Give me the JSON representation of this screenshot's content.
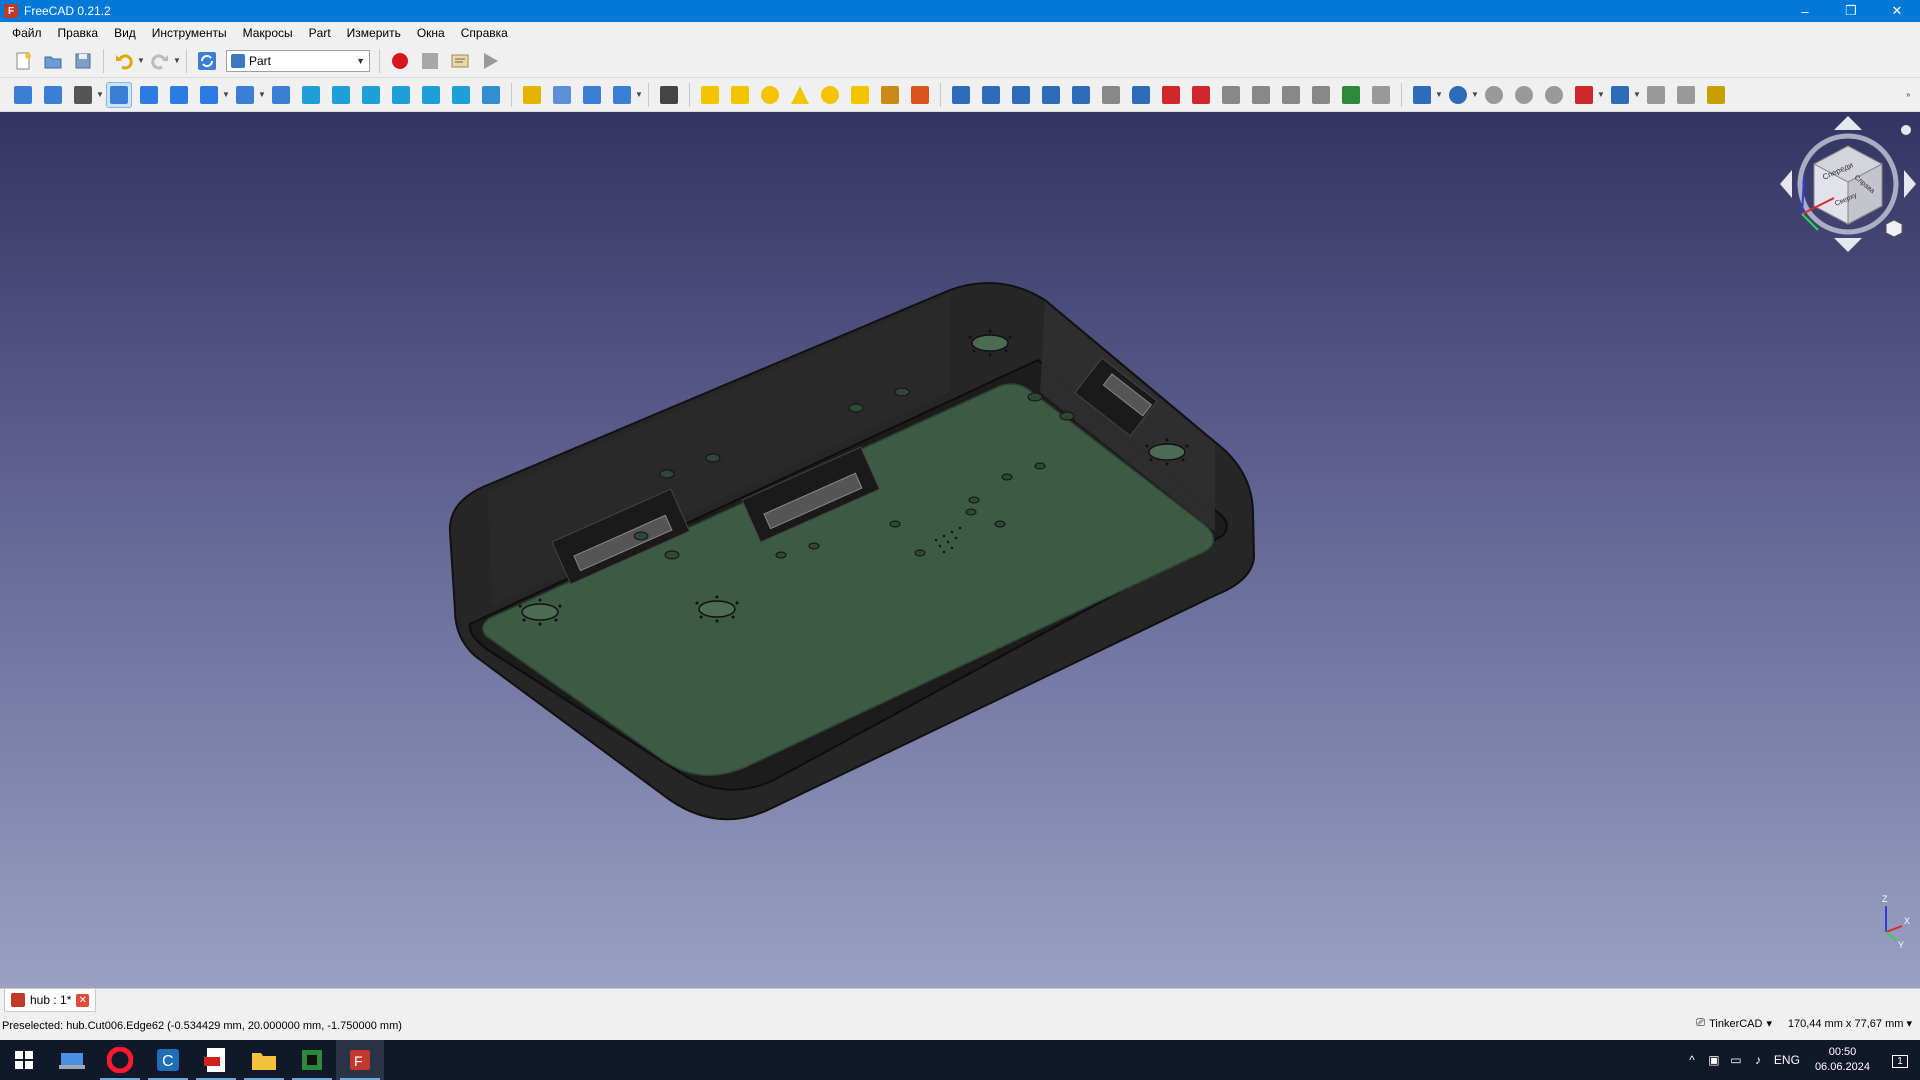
{
  "window": {
    "title": "FreeCAD 0.21.2",
    "controls": {
      "minimize": "–",
      "restore": "❐",
      "close": "✕"
    }
  },
  "menu": [
    "Файл",
    "Правка",
    "Вид",
    "Инструменты",
    "Макросы",
    "Part",
    "Измерить",
    "Окна",
    "Справка"
  ],
  "toolbar1": {
    "workbench": "Part",
    "buttons": [
      "new-file",
      "open-file",
      "save-file",
      "undo",
      "redo",
      "refresh",
      "record-macro",
      "stop-macro",
      "edit-macro",
      "run-macro"
    ]
  },
  "toolbar2": {
    "groups": [
      [
        "fit-all",
        "fit-selection",
        "draw-style",
        "bounding-box",
        "back",
        "forward",
        "sync-view",
        "zoom",
        "isometric",
        "front",
        "top",
        "right",
        "rear",
        "bottom",
        "left",
        "measure"
      ],
      [
        "create-part",
        "create-group",
        "link",
        "link-actions"
      ],
      [
        "whats-this"
      ],
      [
        "cube",
        "cylinder",
        "sphere",
        "cone",
        "torus",
        "tube",
        "primitives",
        "shape-builder"
      ],
      [
        "extrude",
        "revolve",
        "mirror",
        "fillet",
        "chamfer",
        "make-face",
        "ruled-surface",
        "loft",
        "sweep",
        "section",
        "cross-sections",
        "offset",
        "thickness",
        "projection-on-surface",
        "attachment"
      ],
      [
        "compound",
        "boolean",
        "cut",
        "fuse",
        "common",
        "join",
        "split",
        "check-geometry",
        "defeaturing",
        "color-per-face"
      ]
    ]
  },
  "navcube": {
    "face_front": "Спереди",
    "face_right": "Справа",
    "face_top": "Сверху"
  },
  "axis": {
    "x": "X",
    "y": "Y",
    "z": "Z"
  },
  "doc_tab": {
    "label": "hub : 1*",
    "close": "✕"
  },
  "status": {
    "message": "Preselected: hub.Cut006.Edge62 (-0.534429 mm, 20.000000 mm, -1.750000 mm)",
    "nav_style": "TinkerCAD",
    "dimensions": "170,44 mm x 77,67 mm"
  },
  "taskbar": {
    "apps": [
      "start",
      "explorer-window",
      "opera",
      "c-app",
      "pdf-reader",
      "file-explorer",
      "pcb-app",
      "freecad"
    ],
    "lang": "ENG",
    "time": "00:50",
    "date": "06.06.2024",
    "notifications": "1"
  },
  "colors": {
    "titlebar": "#0078d7",
    "bg_top": "#343462",
    "bg_bottom": "#9aa0c2",
    "pcb": "#3d5a45",
    "enclosure": "#2a2a2a"
  }
}
